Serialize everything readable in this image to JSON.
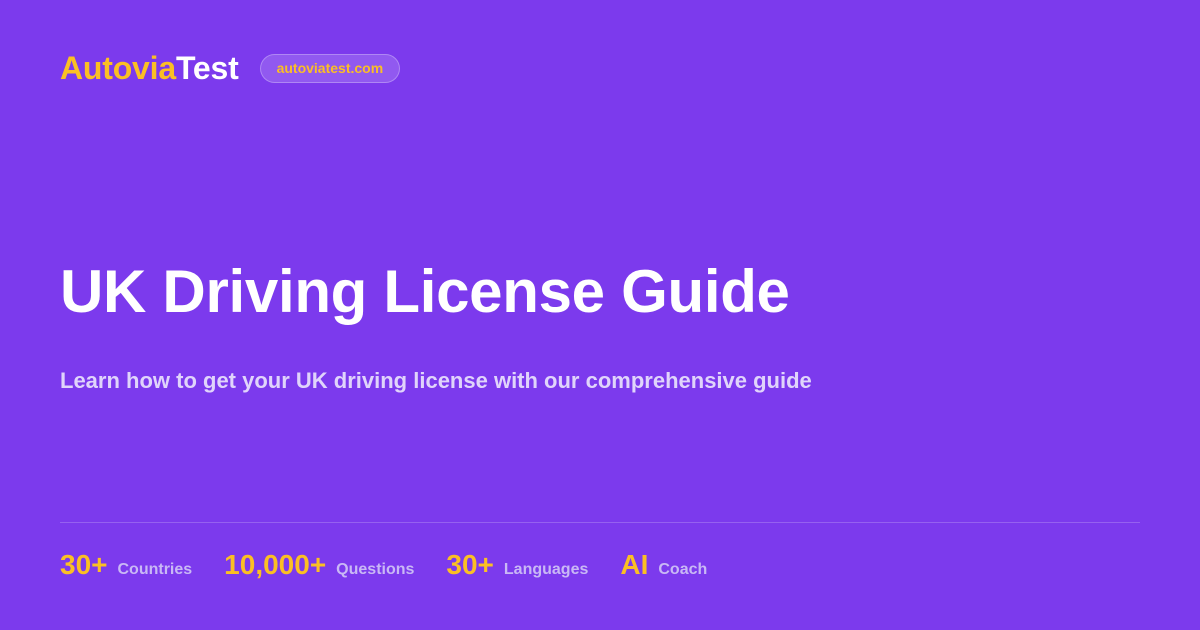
{
  "brand": {
    "logo_accent": "Autovia",
    "logo_main": "Test",
    "domain": "autoviatest.com"
  },
  "hero": {
    "title": "UK Driving License Guide",
    "subtitle": "Learn how to get your UK driving license with our comprehensive guide"
  },
  "stats": [
    {
      "value": "30+",
      "label": "Countries"
    },
    {
      "value": "10,000+",
      "label": "Questions"
    },
    {
      "value": "30+",
      "label": "Languages"
    },
    {
      "value": "AI",
      "label": "Coach"
    }
  ],
  "colors": {
    "background": "#7c3aed",
    "accent": "#fbbf24",
    "text": "#ffffff"
  }
}
